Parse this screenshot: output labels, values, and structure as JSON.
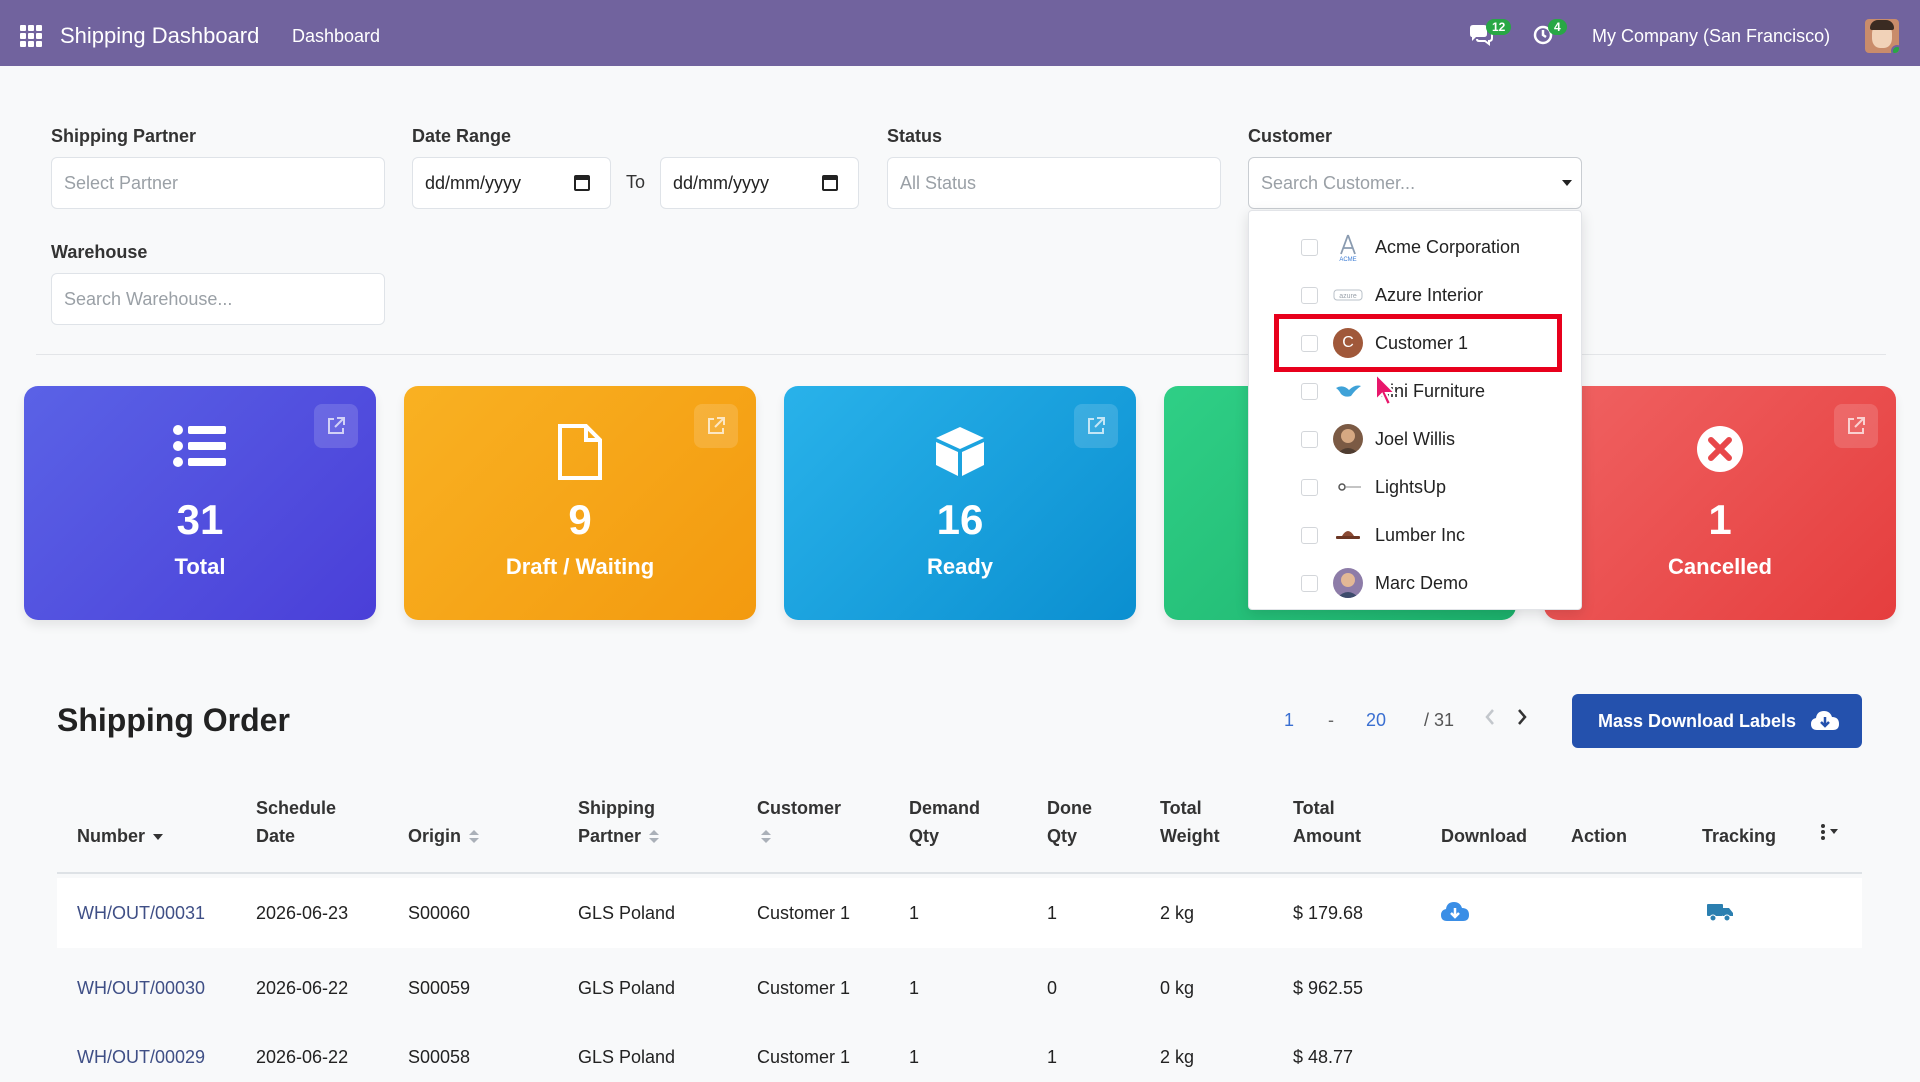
{
  "topbar": {
    "app_title": "Shipping Dashboard",
    "menu_link": "Dashboard",
    "messages_badge": "12",
    "activities_badge": "4",
    "company": "My Company (San Francisco)"
  },
  "filters": {
    "shipping_partner": {
      "label": "Shipping Partner",
      "placeholder": "Select Partner"
    },
    "date_range": {
      "label": "Date Range",
      "from_value": "dd/mm/yyyy",
      "to_label": "To",
      "to_value": "dd/mm/yyyy"
    },
    "status": {
      "label": "Status",
      "placeholder": "All Status"
    },
    "customer": {
      "label": "Customer",
      "placeholder": "Search Customer..."
    },
    "warehouse": {
      "label": "Warehouse",
      "placeholder": "Search Warehouse..."
    }
  },
  "customer_dropdown": {
    "items": [
      {
        "name": "Acme Corporation",
        "icon": "acme-logo-icon",
        "checked": false
      },
      {
        "name": "Azure Interior",
        "icon": "azure-logo-icon",
        "checked": false
      },
      {
        "name": "Customer 1",
        "icon": "letter-c-avatar-icon",
        "checked": false,
        "avatar_letter": "C",
        "highlighted": true
      },
      {
        "name": "mini Furniture",
        "icon": "bird-logo-icon",
        "checked": false
      },
      {
        "name": "Joel Willis",
        "icon": "person-avatar-icon",
        "checked": false
      },
      {
        "name": "LightsUp",
        "icon": "lightsup-logo-icon",
        "checked": false
      },
      {
        "name": "Lumber Inc",
        "icon": "hat-logo-icon",
        "checked": false
      },
      {
        "name": "Marc Demo",
        "icon": "person-avatar-icon",
        "checked": false
      }
    ]
  },
  "stat_cards": [
    {
      "value": "31",
      "label": "Total",
      "icon": "list-icon",
      "color": "#4f52e0"
    },
    {
      "value": "9",
      "label": "Draft / Waiting",
      "icon": "document-icon",
      "color": "#f6a518"
    },
    {
      "value": "16",
      "label": "Ready",
      "icon": "box-icon",
      "color": "#1aa0de"
    },
    {
      "value": "",
      "label": "",
      "icon": "",
      "color": "#25c078"
    },
    {
      "value": "1",
      "label": "Cancelled",
      "icon": "cancel-circle-icon",
      "color": "#ea4a4a"
    }
  ],
  "orders": {
    "title": "Shipping Order",
    "pager": {
      "start": "1",
      "dash": "-",
      "end": "20",
      "total": "/ 31"
    },
    "mass_download_label": "Mass Download Labels",
    "columns": {
      "number": "Number",
      "schedule_date_1": "Schedule",
      "schedule_date_2": "Date",
      "origin": "Origin",
      "shipping_partner_1": "Shipping",
      "shipping_partner_2": "Partner",
      "customer": "Customer",
      "demand_qty_1": "Demand",
      "demand_qty_2": "Qty",
      "done_qty_1": "Done",
      "done_qty_2": "Qty",
      "total_weight_1": "Total",
      "total_weight_2": "Weight",
      "total_amount_1": "Total",
      "total_amount_2": "Amount",
      "download": "Download",
      "action": "Action",
      "tracking": "Tracking"
    },
    "rows": [
      {
        "number": "WH/OUT/00031",
        "date": "2026-06-23",
        "origin": "S00060",
        "partner": "GLS Poland",
        "customer": "Customer 1",
        "demand": "1",
        "done": "1",
        "weight": "2 kg",
        "amount": "$ 179.68"
      },
      {
        "number": "WH/OUT/00030",
        "date": "2026-06-22",
        "origin": "S00059",
        "partner": "GLS Poland",
        "customer": "Customer 1",
        "demand": "1",
        "done": "0",
        "weight": "0 kg",
        "amount": "$ 962.55"
      },
      {
        "number": "WH/OUT/00029",
        "date": "2026-06-22",
        "origin": "S00058",
        "partner": "GLS Poland",
        "customer": "Customer 1",
        "demand": "1",
        "done": "1",
        "weight": "2 kg",
        "amount": "$ 48.77"
      }
    ]
  },
  "colors": {
    "topbar": "#71639e",
    "link": "#3f4f86",
    "primary_button": "#2451ad",
    "highlight": "#e8001c"
  }
}
